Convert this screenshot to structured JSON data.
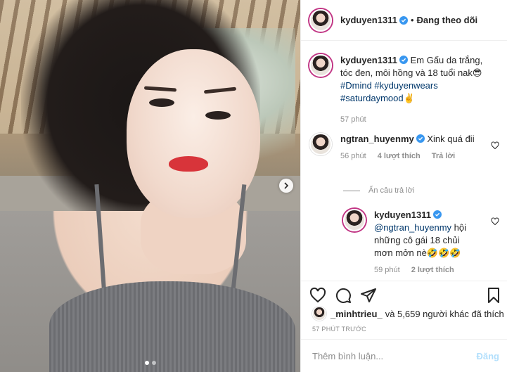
{
  "post": {
    "author": "kyduyen1311",
    "follow_status": "Đang theo dõi",
    "separator": "•",
    "caption": {
      "text_line1": "Em Gấu da trắng,",
      "text_line2": "tóc đen, môi hồng và 18 tuổi nak😎",
      "hashtags_line1": "#Dmind #kyduyenwears",
      "hashtags_line2": "#saturdaymood✌️",
      "time": "57 phút"
    },
    "comments": [
      {
        "username": "ngtran_huyenmy",
        "text": "Xink quá đii",
        "time": "56 phút",
        "likes": "4 lượt thích",
        "reply_label": "Trả lời"
      }
    ],
    "hide_replies_label": "Ẩn câu trả lời",
    "replies": [
      {
        "username": "kyduyen1311",
        "mention": "@ngtran_huyenmy",
        "text": "hội những cô gái 18 chủi mơn mởn nè🤣🤣🤣",
        "time": "59 phút",
        "likes": "2 lượt thích"
      }
    ],
    "liked_by": {
      "user": "_minhtrieu_",
      "rest": "và 5,659 người khác đã thích"
    },
    "timestamp": "57 PHÚT TRƯỚC",
    "comment_input": {
      "placeholder": "Thêm bình luận...",
      "value": ""
    },
    "post_button": "Đăng"
  },
  "carousel": {
    "slide_count": 2,
    "active_index": 1
  },
  "colors": {
    "text": "#262626",
    "secondary": "#8e8e8e",
    "hashtag": "#00376b",
    "verified": "#3897f0",
    "post_disabled": "#b2dffc"
  },
  "icons": {
    "verified": "verified-badge-icon",
    "carousel_next": "chevron-right-icon",
    "like": "heart-icon",
    "comment": "comment-bubble-icon",
    "share": "paper-plane-icon",
    "save": "bookmark-icon"
  }
}
